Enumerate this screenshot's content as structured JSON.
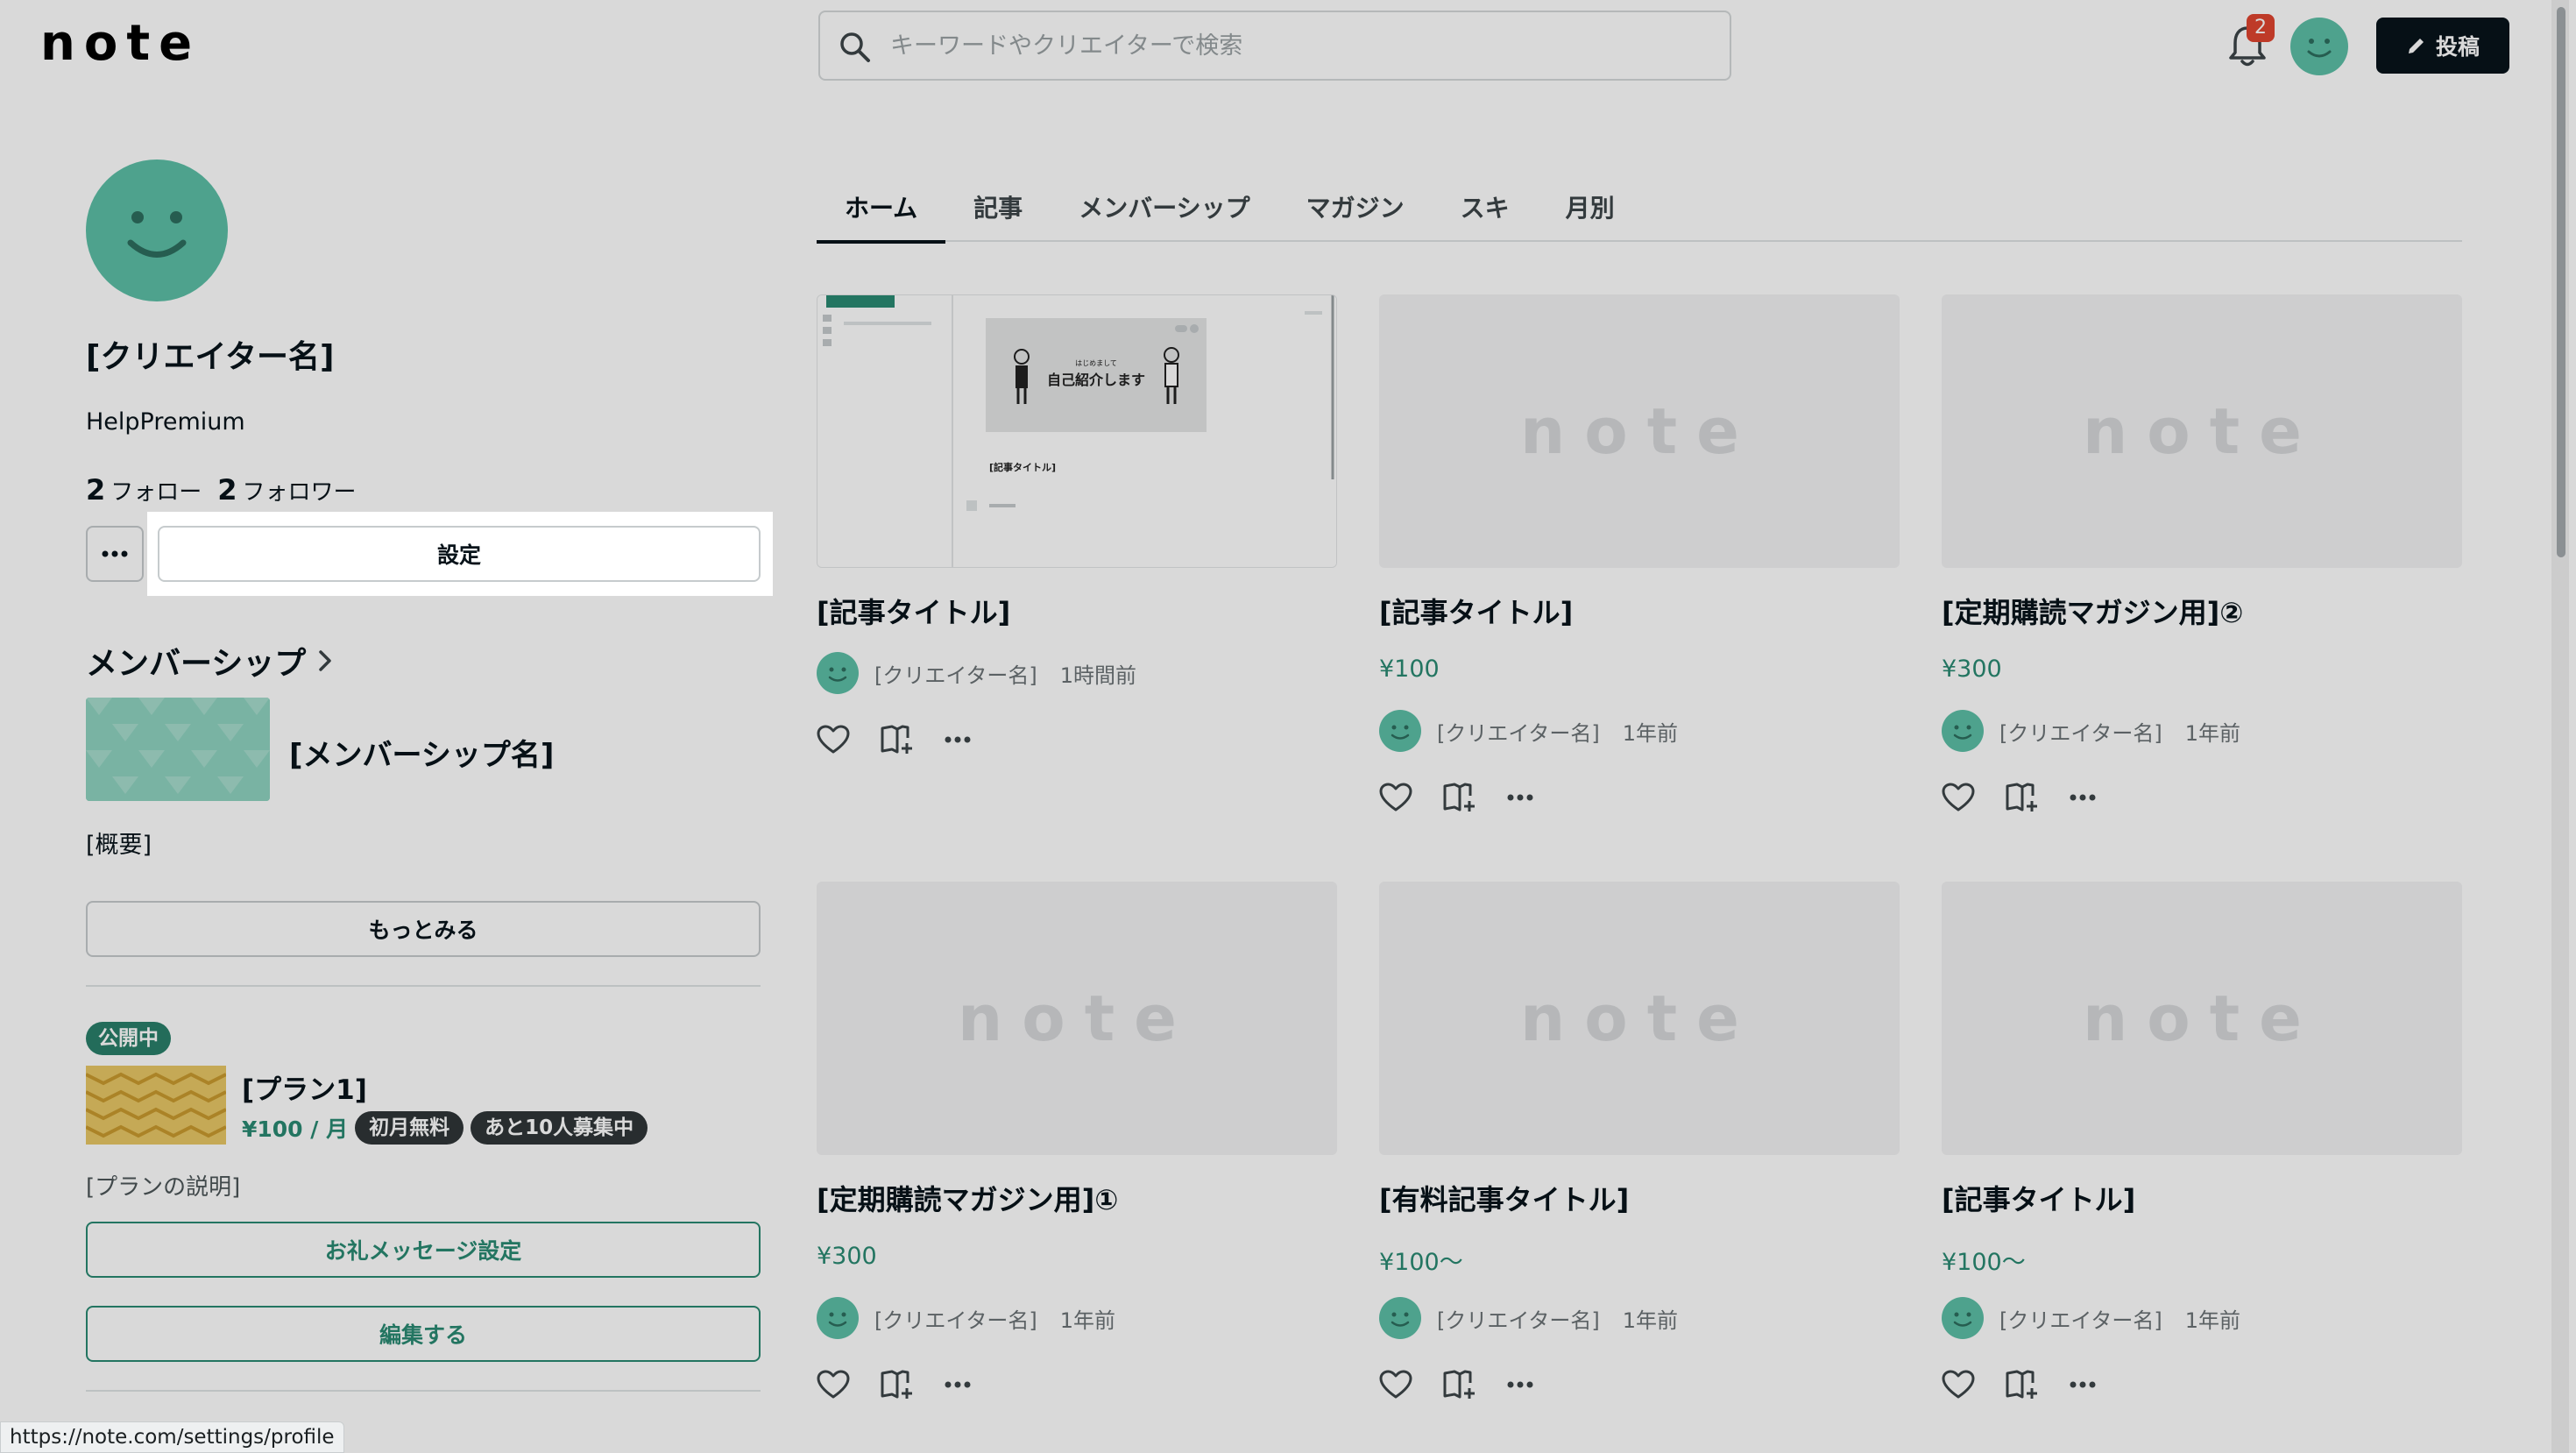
{
  "header": {
    "logo": "note",
    "search_placeholder": "キーワードやクリエイターで検索",
    "notification_count": "2",
    "post_label": "投稿"
  },
  "profile": {
    "creator_name": "[クリエイター名]",
    "plan_label": "HelpPremium",
    "follow_count": "2",
    "follow_label": "フォロー",
    "follower_count": "2",
    "follower_label": "フォロワー",
    "settings_label": "設定"
  },
  "membership": {
    "title": "メンバーシップ",
    "name": "[メンバーシップ名]",
    "description": "[概要]",
    "more_label": "もっとみる",
    "plan": {
      "status": "公開中",
      "name": "[プラン1]",
      "price": "¥100 / 月",
      "badges": [
        "初月無料",
        "あと10人募集中"
      ],
      "description": "[プランの説明]",
      "thanks_label": "お礼メッセージ設定",
      "edit_label": "編集する"
    }
  },
  "tabs": [
    "ホーム",
    "記事",
    "メンバーシップ",
    "マガジン",
    "スキ",
    "月別"
  ],
  "preview": {
    "caption": "はじめまして",
    "title": "自己紹介します",
    "article_title": "[記事タイトル]"
  },
  "cards": [
    {
      "title": "[記事タイトル]",
      "price": "",
      "creator": "[クリエイター名]",
      "time": "1時間前"
    },
    {
      "title": "[記事タイトル]",
      "price": "¥100",
      "creator": "[クリエイター名]",
      "time": "1年前"
    },
    {
      "title": "[定期購読マガジン用]②",
      "price": "¥300",
      "creator": "[クリエイター名]",
      "time": "1年前"
    },
    {
      "title": "[定期購読マガジン用]①",
      "price": "¥300",
      "creator": "[クリエイター名]",
      "time": "1年前"
    },
    {
      "title": "[有料記事タイトル]",
      "price": "¥100〜",
      "creator": "[クリエイター名]",
      "time": "1年前"
    },
    {
      "title": "[記事タイトル]",
      "price": "¥100〜",
      "creator": "[クリエイター名]",
      "time": "1年前"
    }
  ],
  "statusbar": {
    "url": "https://note.com/settings/profile"
  },
  "colors": {
    "accent": "#2a8a72",
    "avatar": "#5cbfa6",
    "badge": "#e0452f"
  }
}
